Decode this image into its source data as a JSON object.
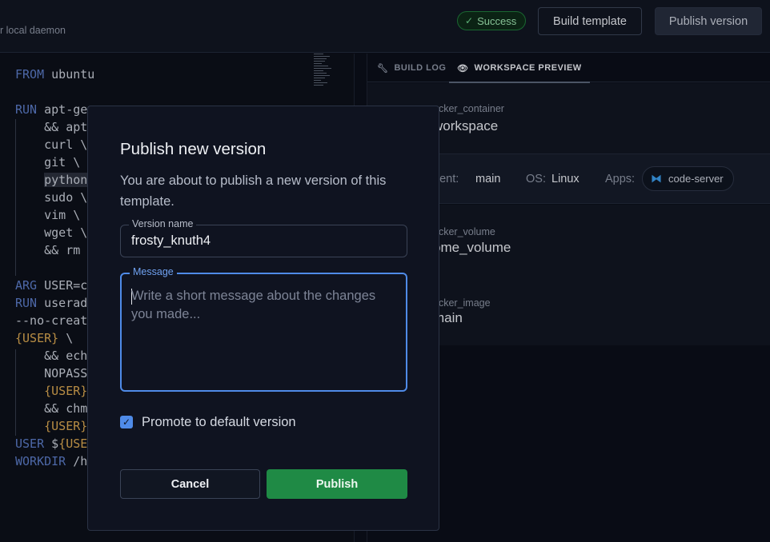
{
  "topbar": {
    "subtitle": "r local daemon",
    "status_badge": "Success",
    "build_button": "Build template",
    "publish_button": "Publish version"
  },
  "editor": {
    "lines": [
      "FROM ubuntu",
      "",
      "RUN apt-ge",
      "    && apt",
      "    curl \\",
      "    git \\",
      "    python",
      "    sudo \\",
      "    vim \\",
      "    wget \\",
      "    && rm",
      "",
      "ARG USER=c",
      "RUN userad",
      "--no-creat",
      "{USER} \\",
      "    && ech",
      "    NOPASS",
      "    {USER}",
      "    && chm",
      "    {USER}",
      "USER ${USE",
      "WORKDIR /h"
    ]
  },
  "right_panel": {
    "tabs": [
      {
        "label": "BUILD LOG",
        "icon": "wrench-icon"
      },
      {
        "label": "WORKSPACE PREVIEW",
        "icon": "eye-icon"
      }
    ],
    "resources": [
      {
        "type": "ocker_container",
        "name": "workspace"
      },
      {
        "type": "ocker_volume",
        "name": "ome_volume"
      },
      {
        "type": "ocker_image",
        "name": "main"
      }
    ],
    "agent": {
      "agent_label": "gent:",
      "agent_value": "main",
      "os_label": "OS:",
      "os_value": "Linux",
      "apps_label": "Apps:",
      "app_name": "code-server"
    }
  },
  "modal": {
    "title": "Publish new version",
    "description": "You are about to publish a new version of this template.",
    "version_label": "Version name",
    "version_value": "frosty_knuth4",
    "message_label": "Message",
    "message_placeholder": "Write a short message about the changes you made...",
    "promote_label": "Promote to default version",
    "promote_checked": true,
    "cancel_button": "Cancel",
    "publish_button": "Publish"
  },
  "colors": {
    "publish_green": "#1f8a45",
    "focus_blue": "#4f8be8",
    "success": "#6fd18e"
  }
}
